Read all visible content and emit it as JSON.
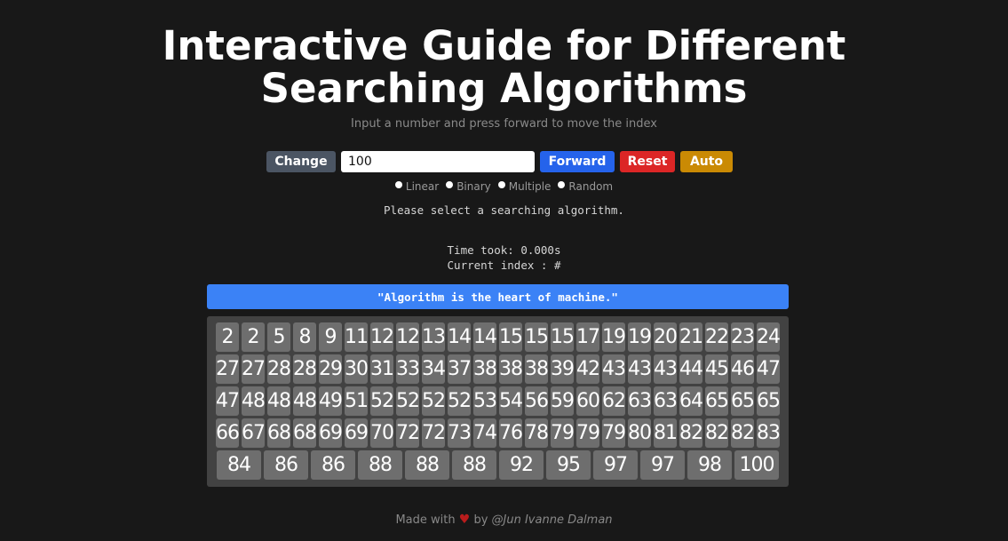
{
  "header": {
    "title_line1": "Interactive Guide for Different",
    "title_line2": "Searching Algorithms",
    "subtitle": "Input a number and press forward to move the index"
  },
  "controls": {
    "change_label": "Change",
    "input_value": "100",
    "forward_label": "Forward",
    "reset_label": "Reset",
    "auto_label": "Auto"
  },
  "algorithms": [
    "Linear",
    "Binary",
    "Multiple",
    "Random"
  ],
  "status": {
    "message": "Please select a searching algorithm.",
    "time": "Time took: 0.000s",
    "index": "Current index : #"
  },
  "quote": "\"Algorithm is the heart of machine.\"",
  "array_rows": [
    [
      "2",
      "2",
      "5",
      "8",
      "9",
      "11",
      "12",
      "12",
      "13",
      "14",
      "14",
      "15",
      "15",
      "15",
      "17",
      "19",
      "19",
      "20",
      "21",
      "22",
      "23",
      "24"
    ],
    [
      "27",
      "27",
      "28",
      "28",
      "29",
      "30",
      "31",
      "33",
      "34",
      "37",
      "38",
      "38",
      "38",
      "39",
      "42",
      "43",
      "43",
      "43",
      "44",
      "45",
      "46",
      "47"
    ],
    [
      "47",
      "48",
      "48",
      "48",
      "49",
      "51",
      "52",
      "52",
      "52",
      "52",
      "53",
      "54",
      "56",
      "59",
      "60",
      "62",
      "63",
      "63",
      "64",
      "65",
      "65",
      "65"
    ],
    [
      "66",
      "67",
      "68",
      "68",
      "69",
      "69",
      "70",
      "72",
      "72",
      "73",
      "74",
      "76",
      "78",
      "79",
      "79",
      "79",
      "80",
      "81",
      "82",
      "82",
      "82",
      "83"
    ],
    [
      "84",
      "86",
      "86",
      "88",
      "88",
      "88",
      "92",
      "95",
      "97",
      "97",
      "98",
      "100"
    ]
  ],
  "footer": {
    "made_with": "Made with",
    "heart_icon": "heart-icon",
    "by": "by",
    "author": "@Jun Ivanne Dalman"
  }
}
